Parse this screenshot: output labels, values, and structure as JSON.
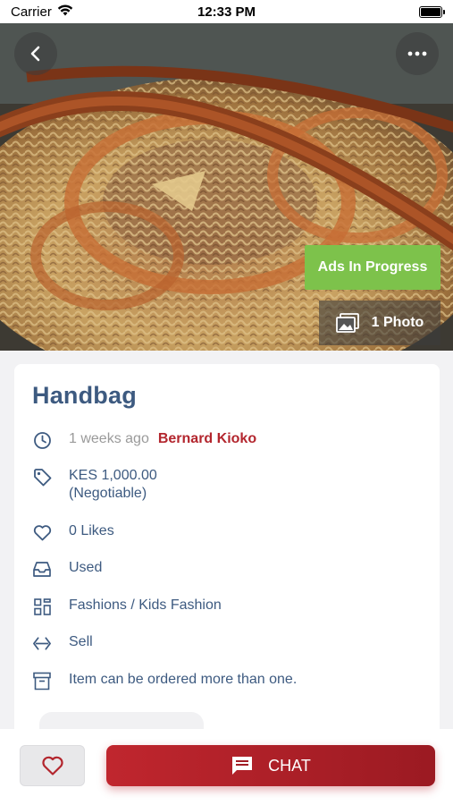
{
  "status_bar": {
    "carrier": "Carrier",
    "time": "12:33 PM"
  },
  "hero": {
    "badge": "Ads In Progress",
    "photo_count": "1 Photo"
  },
  "listing": {
    "title": "Handbag",
    "time_ago": "1 weeks ago",
    "seller": "Bernard Kioko",
    "price": "KES 1,000.00",
    "price_note": "(Negotiable)",
    "likes": "0 Likes",
    "condition": "Used",
    "category": "Fashions / Kids Fashion",
    "type": "Sell",
    "order_note": "Item can be ordered more than one."
  },
  "actions": {
    "chat_label": "CHAT"
  },
  "colors": {
    "accent_red": "#b3262e",
    "title_blue": "#3d5a80",
    "badge_green": "#7dc24b"
  },
  "icons": [
    "back-icon",
    "more-icon",
    "image-icon",
    "clock-icon",
    "tag-icon",
    "heart-icon",
    "inbox-icon",
    "grid-icon",
    "swap-icon",
    "archive-icon",
    "chat-icon"
  ]
}
